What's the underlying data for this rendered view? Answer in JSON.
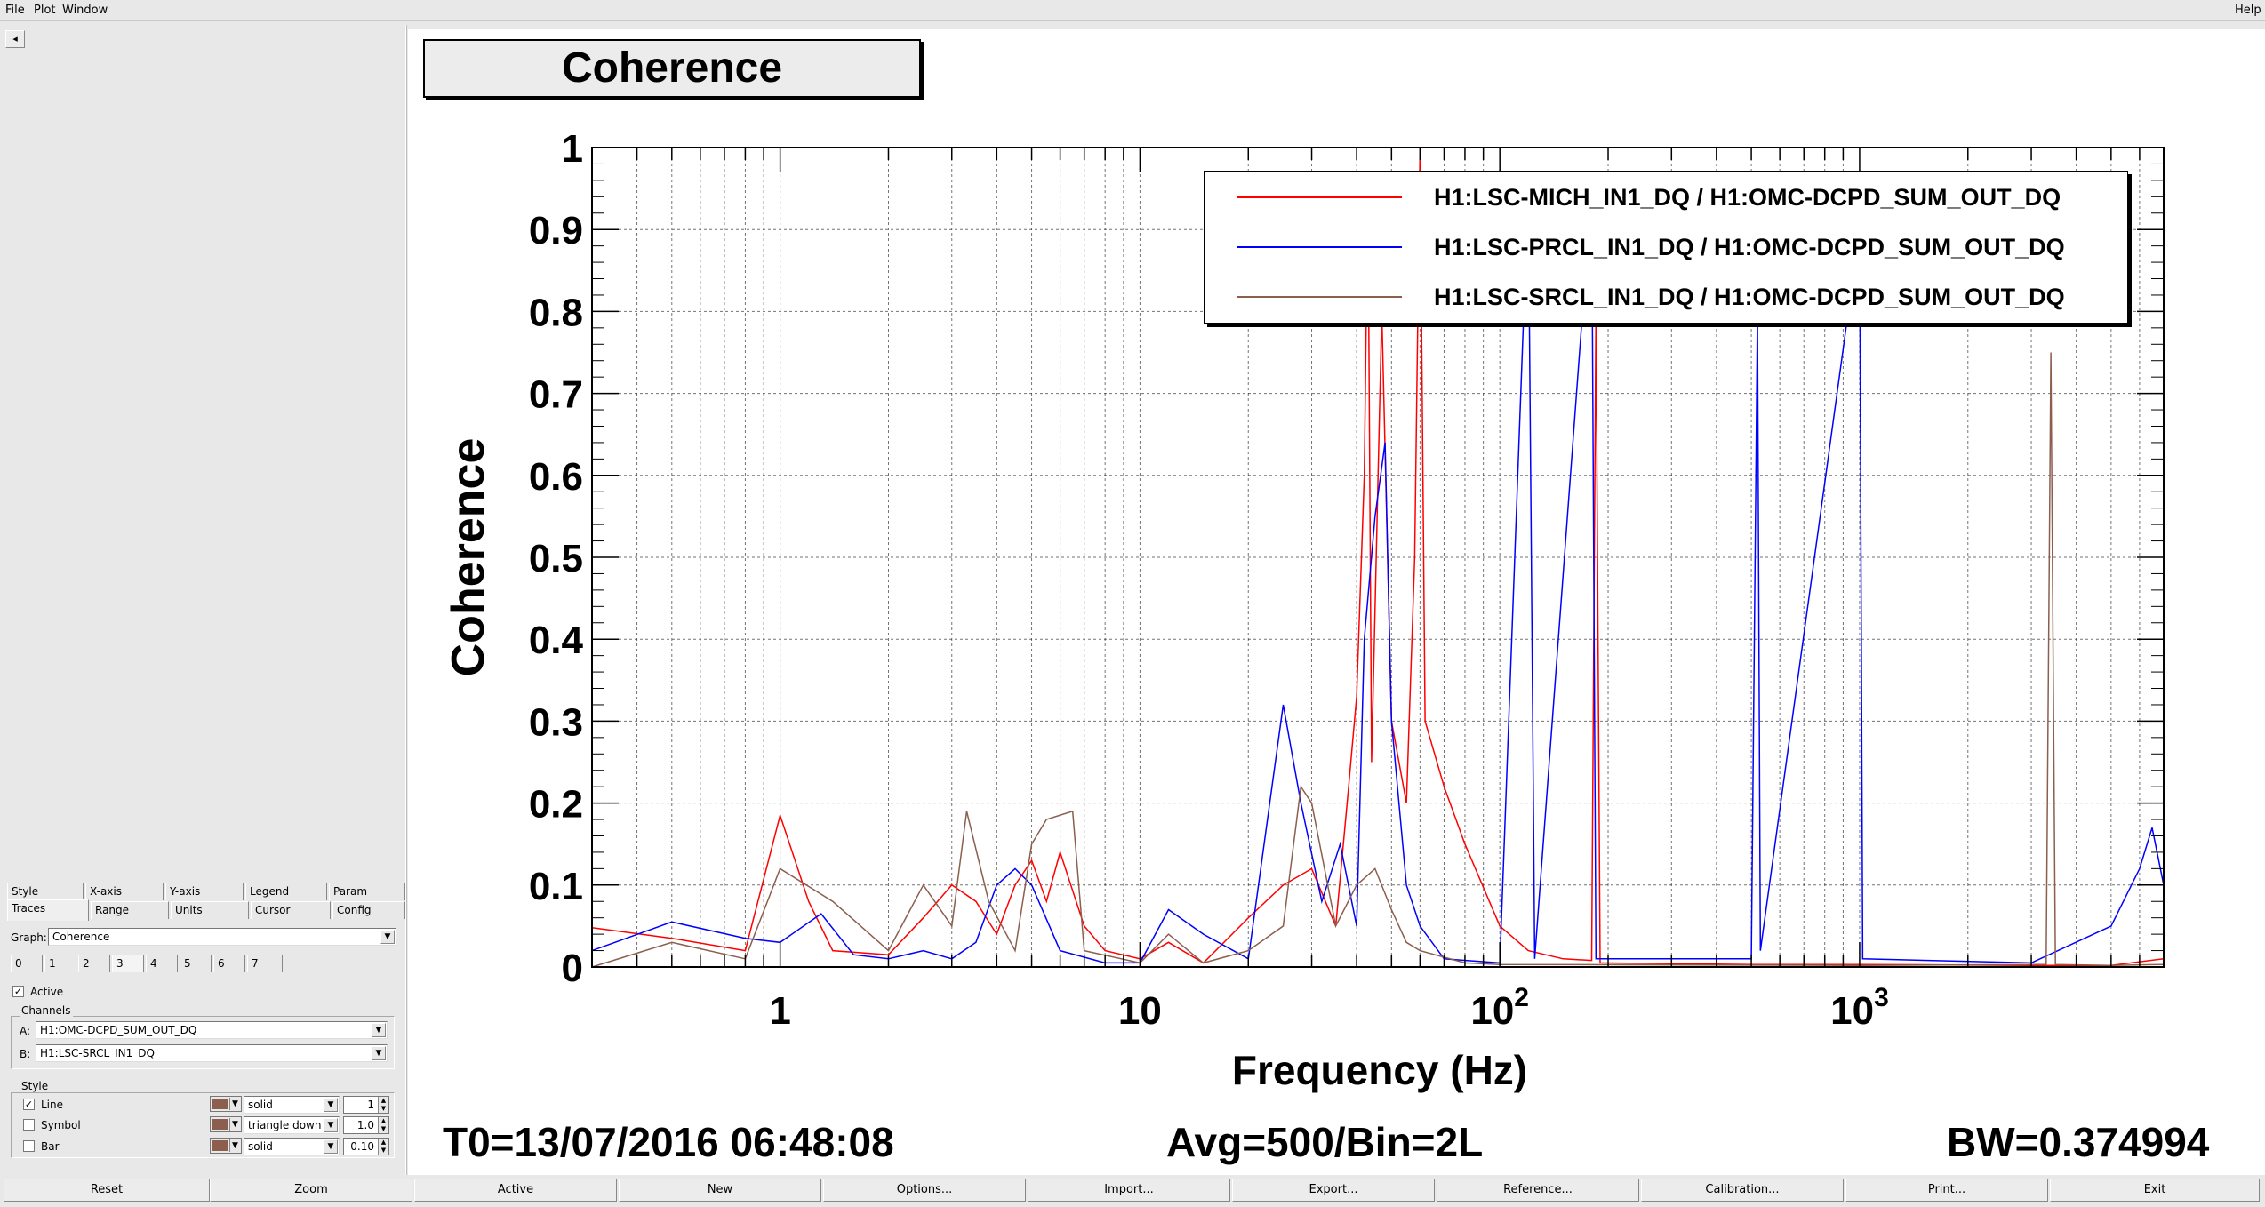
{
  "menubar": {
    "file": "File",
    "plot": "Plot",
    "window": "Window",
    "help": "Help"
  },
  "left_panel": {
    "collapse_glyph": "◂",
    "tabs_row1": [
      "Style",
      "X-axis",
      "Y-axis",
      "Legend",
      "Param"
    ],
    "tabs_row2": [
      "Traces",
      "Range",
      "Units",
      "Cursor",
      "Config"
    ],
    "active_tab": "Traces",
    "graph_label": "Graph:",
    "graph_value": "Coherence",
    "trace_tabs": [
      "0",
      "1",
      "2",
      "3",
      "4",
      "5",
      "6",
      "7"
    ],
    "active_trace": "3",
    "active_label": "Active",
    "active_check": "✓",
    "channels_title": "Channels",
    "channel_a_label": "A:",
    "channel_a_value": "H1:OMC-DCPD_SUM_OUT_DQ",
    "channel_b_label": "B:",
    "channel_b_value": "H1:LSC-SRCL_IN1_DQ",
    "style_title": "Style",
    "line_label": "Line",
    "line_check": "✓",
    "line_style": "solid",
    "line_width": "1",
    "symbol_label": "Symbol",
    "symbol_style": "triangle down",
    "symbol_size": "1.0",
    "bar_label": "Bar",
    "bar_style": "solid",
    "bar_width": "0.10",
    "trace_color": "#8b5e4e"
  },
  "plot": {
    "title": "Coherence",
    "t0": "T0=13/07/2016 06:48:08",
    "avg": "Avg=500/Bin=2L",
    "bw": "BW=0.374994"
  },
  "chart_data": {
    "type": "line",
    "title": "Coherence",
    "xlabel": "Frequency (Hz)",
    "ylabel": "Coherence",
    "xscale": "log",
    "xlim": [
      0.3,
      7000
    ],
    "ylim": [
      0,
      1
    ],
    "yticks": [
      "0",
      "0.1",
      "0.2",
      "0.3",
      "0.4",
      "0.5",
      "0.6",
      "0.7",
      "0.8",
      "0.9",
      "1"
    ],
    "xtick_labels": [
      {
        "value": 1,
        "text": "1",
        "sup": ""
      },
      {
        "value": 10,
        "text": "10",
        "sup": ""
      },
      {
        "value": 100,
        "text": "10",
        "sup": "2"
      },
      {
        "value": 1000,
        "text": "10",
        "sup": "3"
      }
    ],
    "grid": true,
    "legend_position": "top-right",
    "series": [
      {
        "name": "H1:LSC-MICH_IN1_DQ / H1:OMC-DCPD_SUM_OUT_DQ",
        "color": "#ff0000",
        "points": [
          [
            0.3,
            0.048
          ],
          [
            0.5,
            0.035
          ],
          [
            0.8,
            0.02
          ],
          [
            1.0,
            0.185
          ],
          [
            1.2,
            0.08
          ],
          [
            1.4,
            0.02
          ],
          [
            2,
            0.015
          ],
          [
            2.5,
            0.06
          ],
          [
            3,
            0.1
          ],
          [
            3.5,
            0.08
          ],
          [
            4,
            0.04
          ],
          [
            4.5,
            0.1
          ],
          [
            5,
            0.13
          ],
          [
            5.5,
            0.08
          ],
          [
            6,
            0.14
          ],
          [
            7,
            0.05
          ],
          [
            8,
            0.02
          ],
          [
            10,
            0.01
          ],
          [
            12,
            0.03
          ],
          [
            15,
            0.005
          ],
          [
            20,
            0.06
          ],
          [
            25,
            0.1
          ],
          [
            30,
            0.12
          ],
          [
            35,
            0.05
          ],
          [
            38,
            0.22
          ],
          [
            40,
            0.33
          ],
          [
            42,
            0.6
          ],
          [
            43,
            0.95
          ],
          [
            44,
            0.25
          ],
          [
            47,
            0.8
          ],
          [
            50,
            0.3
          ],
          [
            55,
            0.2
          ],
          [
            58,
            0.5
          ],
          [
            60,
            1.0
          ],
          [
            62,
            0.3
          ],
          [
            70,
            0.22
          ],
          [
            80,
            0.15
          ],
          [
            100,
            0.05
          ],
          [
            120,
            0.02
          ],
          [
            150,
            0.01
          ],
          [
            180,
            0.008
          ],
          [
            185,
            0.8
          ],
          [
            190,
            0.005
          ],
          [
            300,
            0.004
          ],
          [
            500,
            0.003
          ],
          [
            1000,
            0.003
          ],
          [
            3000,
            0.002
          ],
          [
            5000,
            0.002
          ],
          [
            7000,
            0.01
          ]
        ]
      },
      {
        "name": "H1:LSC-PRCL_IN1_DQ / H1:OMC-DCPD_SUM_OUT_DQ",
        "color": "#0000ff",
        "points": [
          [
            0.3,
            0.02
          ],
          [
            0.5,
            0.055
          ],
          [
            0.8,
            0.035
          ],
          [
            1.0,
            0.03
          ],
          [
            1.3,
            0.065
          ],
          [
            1.6,
            0.015
          ],
          [
            2,
            0.01
          ],
          [
            2.5,
            0.02
          ],
          [
            3,
            0.01
          ],
          [
            3.5,
            0.03
          ],
          [
            4,
            0.1
          ],
          [
            4.5,
            0.12
          ],
          [
            5,
            0.1
          ],
          [
            6,
            0.02
          ],
          [
            8,
            0.005
          ],
          [
            10,
            0.005
          ],
          [
            12,
            0.07
          ],
          [
            15,
            0.04
          ],
          [
            20,
            0.01
          ],
          [
            25,
            0.32
          ],
          [
            28,
            0.2
          ],
          [
            32,
            0.08
          ],
          [
            36,
            0.15
          ],
          [
            40,
            0.05
          ],
          [
            42,
            0.4
          ],
          [
            45,
            0.55
          ],
          [
            48,
            0.64
          ],
          [
            50,
            0.3
          ],
          [
            55,
            0.1
          ],
          [
            60,
            0.05
          ],
          [
            70,
            0.01
          ],
          [
            100,
            0.005
          ],
          [
            120,
            0.95
          ],
          [
            125,
            0.01
          ],
          [
            180,
            0.95
          ],
          [
            185,
            0.01
          ],
          [
            300,
            0.01
          ],
          [
            500,
            0.01
          ],
          [
            520,
            0.8
          ],
          [
            530,
            0.02
          ],
          [
            1000,
            0.9
          ],
          [
            1020,
            0.01
          ],
          [
            3000,
            0.005
          ],
          [
            5000,
            0.05
          ],
          [
            6000,
            0.12
          ],
          [
            6500,
            0.17
          ],
          [
            7000,
            0.1
          ]
        ]
      },
      {
        "name": "H1:LSC-SRCL_IN1_DQ / H1:OMC-DCPD_SUM_OUT_DQ",
        "color": "#8b5e4e",
        "points": [
          [
            0.3,
            0.0
          ],
          [
            0.5,
            0.03
          ],
          [
            0.8,
            0.01
          ],
          [
            1.0,
            0.12
          ],
          [
            1.4,
            0.08
          ],
          [
            2,
            0.02
          ],
          [
            2.5,
            0.1
          ],
          [
            3,
            0.05
          ],
          [
            3.3,
            0.19
          ],
          [
            3.8,
            0.08
          ],
          [
            4.5,
            0.02
          ],
          [
            5,
            0.15
          ],
          [
            5.5,
            0.18
          ],
          [
            6.5,
            0.19
          ],
          [
            7,
            0.02
          ],
          [
            10,
            0.005
          ],
          [
            12,
            0.04
          ],
          [
            15,
            0.005
          ],
          [
            20,
            0.02
          ],
          [
            25,
            0.05
          ],
          [
            28,
            0.22
          ],
          [
            30,
            0.2
          ],
          [
            35,
            0.05
          ],
          [
            40,
            0.1
          ],
          [
            45,
            0.12
          ],
          [
            50,
            0.07
          ],
          [
            55,
            0.03
          ],
          [
            60,
            0.02
          ],
          [
            80,
            0.005
          ],
          [
            100,
            0.003
          ],
          [
            1000,
            0.002
          ],
          [
            3300,
            0.003
          ],
          [
            3400,
            0.75
          ],
          [
            3500,
            0.003
          ],
          [
            5000,
            0.002
          ],
          [
            7000,
            0.003
          ]
        ]
      }
    ]
  },
  "bottom_buttons": [
    "Reset",
    "Zoom",
    "Active",
    "New",
    "Options...",
    "Import...",
    "Export...",
    "Reference...",
    "Calibration...",
    "Print...",
    "Exit"
  ]
}
